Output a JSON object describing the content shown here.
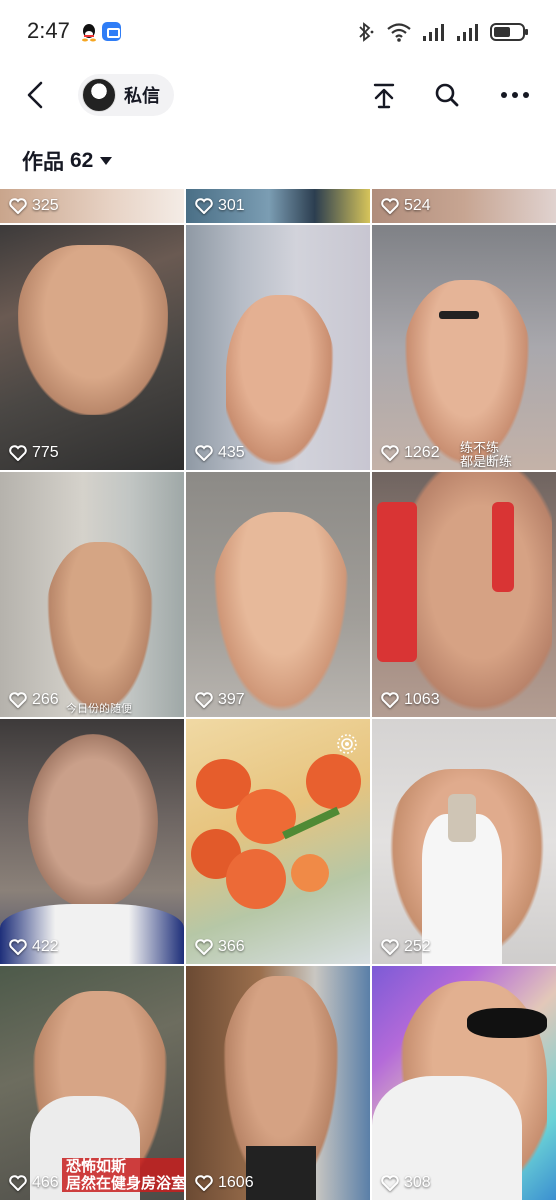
{
  "status_bar": {
    "time": "2:47"
  },
  "nav": {
    "dm_label": "私信"
  },
  "works": {
    "title": "作品",
    "count": "62"
  },
  "tiles_row0": [
    {
      "likes": "325"
    },
    {
      "likes": "301"
    },
    {
      "likes": "524"
    }
  ],
  "tiles": [
    {
      "likes": "775"
    },
    {
      "likes": "435"
    },
    {
      "likes": "1262",
      "caption": "练不练\n都是断练"
    },
    {
      "likes": "266",
      "caption": "今日份的随便"
    },
    {
      "likes": "397"
    },
    {
      "likes": "1063"
    },
    {
      "likes": "422"
    },
    {
      "likes": "366"
    },
    {
      "likes": "252"
    },
    {
      "likes": "466",
      "caption": "恐怖如斯\n居然在健身房浴室"
    },
    {
      "likes": "1606"
    },
    {
      "likes": "308"
    }
  ],
  "colors": {
    "accent": "#161823",
    "pill_bg": "#f2f2f4"
  }
}
